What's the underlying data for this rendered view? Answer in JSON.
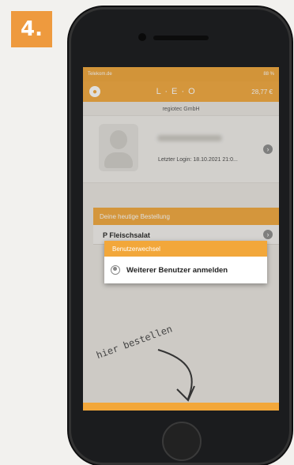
{
  "step": {
    "label": "4."
  },
  "status_bar": {
    "carrier": "Telekom.de",
    "battery": "88 %"
  },
  "app": {
    "title": "L · E · O",
    "balance": "28,77 €",
    "company": "regiotec GmbH",
    "last_login": "Letzter Login: 18.10.2021 21:0..."
  },
  "order": {
    "header": "Deine heutige Bestellung",
    "item": "P Fleischsalat"
  },
  "dialog": {
    "title": "Benutzerwechsel",
    "option": "Weiterer Benutzer anmelden"
  },
  "annotation": {
    "note": "hier bestellen"
  },
  "colors": {
    "accent": "#f2a73a",
    "badge": "#ee9a3e"
  },
  "icons": [
    "user-icon",
    "chevron-right-icon",
    "account-circle-icon",
    "arrow-down-icon"
  ]
}
